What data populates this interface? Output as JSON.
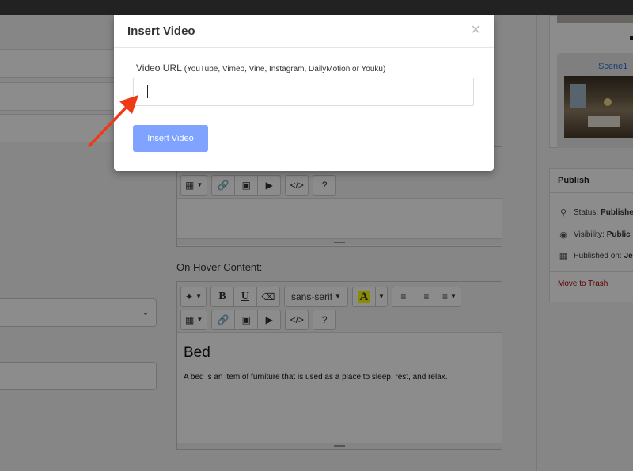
{
  "editor1": {
    "toolbar_row2": [
      "table",
      "link",
      "picture",
      "video",
      "code",
      "help"
    ]
  },
  "editor2": {
    "label": "On Hover Content:",
    "font_name": "sans-serif",
    "help": "?",
    "code": "</>",
    "bold": "B",
    "underline": "U",
    "color_letter": "A",
    "content_title": "Bed",
    "content_text": "A bed is an item of furniture that is used as a place to sleep, rest, and relax."
  },
  "sidebar": {
    "scene_name": "Scene1",
    "publish": {
      "title": "Publish",
      "status_label": "Status:",
      "status_value": "Publishe",
      "visibility_label": "Visibility:",
      "visibility_value": "Public",
      "published_on_label": "Published on:",
      "published_on_value": "Je",
      "trash_label": "Move to Trash"
    }
  },
  "modal": {
    "title": "Insert Video",
    "close": "×",
    "field_label": "Video URL",
    "field_hint": "(YouTube, Vimeo, Vine, Instagram, DailyMotion or Youku)",
    "url_value": "",
    "button_label": "Insert Video"
  },
  "colors": {
    "accent_button": "#7fa3ff",
    "annotation_arrow": "#f03a17",
    "trash_link": "#aa0000",
    "scene_link": "#2d6fd6"
  }
}
